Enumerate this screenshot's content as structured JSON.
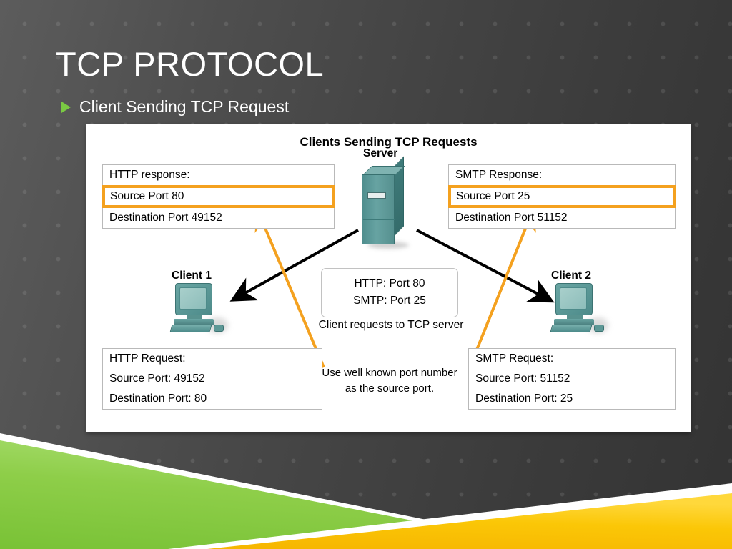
{
  "slide": {
    "title": "TCP PROTOCOL",
    "bullet": "Client Sending TCP Request",
    "bullet_marker_color": "#7ac943"
  },
  "diagram": {
    "title": "Clients Sending TCP Requests",
    "highlight_color": "#f4a11f",
    "arrow_black_color": "#000000",
    "arrow_orange_color": "#f4a11f",
    "device_color": "#4f8e8e",
    "boxes": {
      "http_response": {
        "line1": "HTTP response:",
        "line2": "Source Port 80",
        "line3": "Destination Port 49152"
      },
      "smtp_response": {
        "line1": "SMTP Response:",
        "line2": "Source Port 25",
        "line3": "Destination Port 51152"
      },
      "http_request": {
        "line1": "HTTP Request:",
        "line2": "Source Port: 49152",
        "line3": "Destination Port: 80"
      },
      "smtp_request": {
        "line1": "SMTP Request:",
        "line2": "Source Port: 51152",
        "line3": "Destination Port: 25"
      },
      "ports": {
        "line1": "HTTP: Port 80",
        "line2": "SMTP: Port 25"
      }
    },
    "captions": {
      "center": "Client requests to TCP server",
      "note_line1": "Use well known port number",
      "note_line2": "as the source port."
    },
    "devices": {
      "server": "Server",
      "client1": "Client 1",
      "client2": "Client 2"
    }
  },
  "banner": {
    "green": "#86cc3f",
    "yellow": "#fbc707",
    "divider": "#ffffff"
  }
}
